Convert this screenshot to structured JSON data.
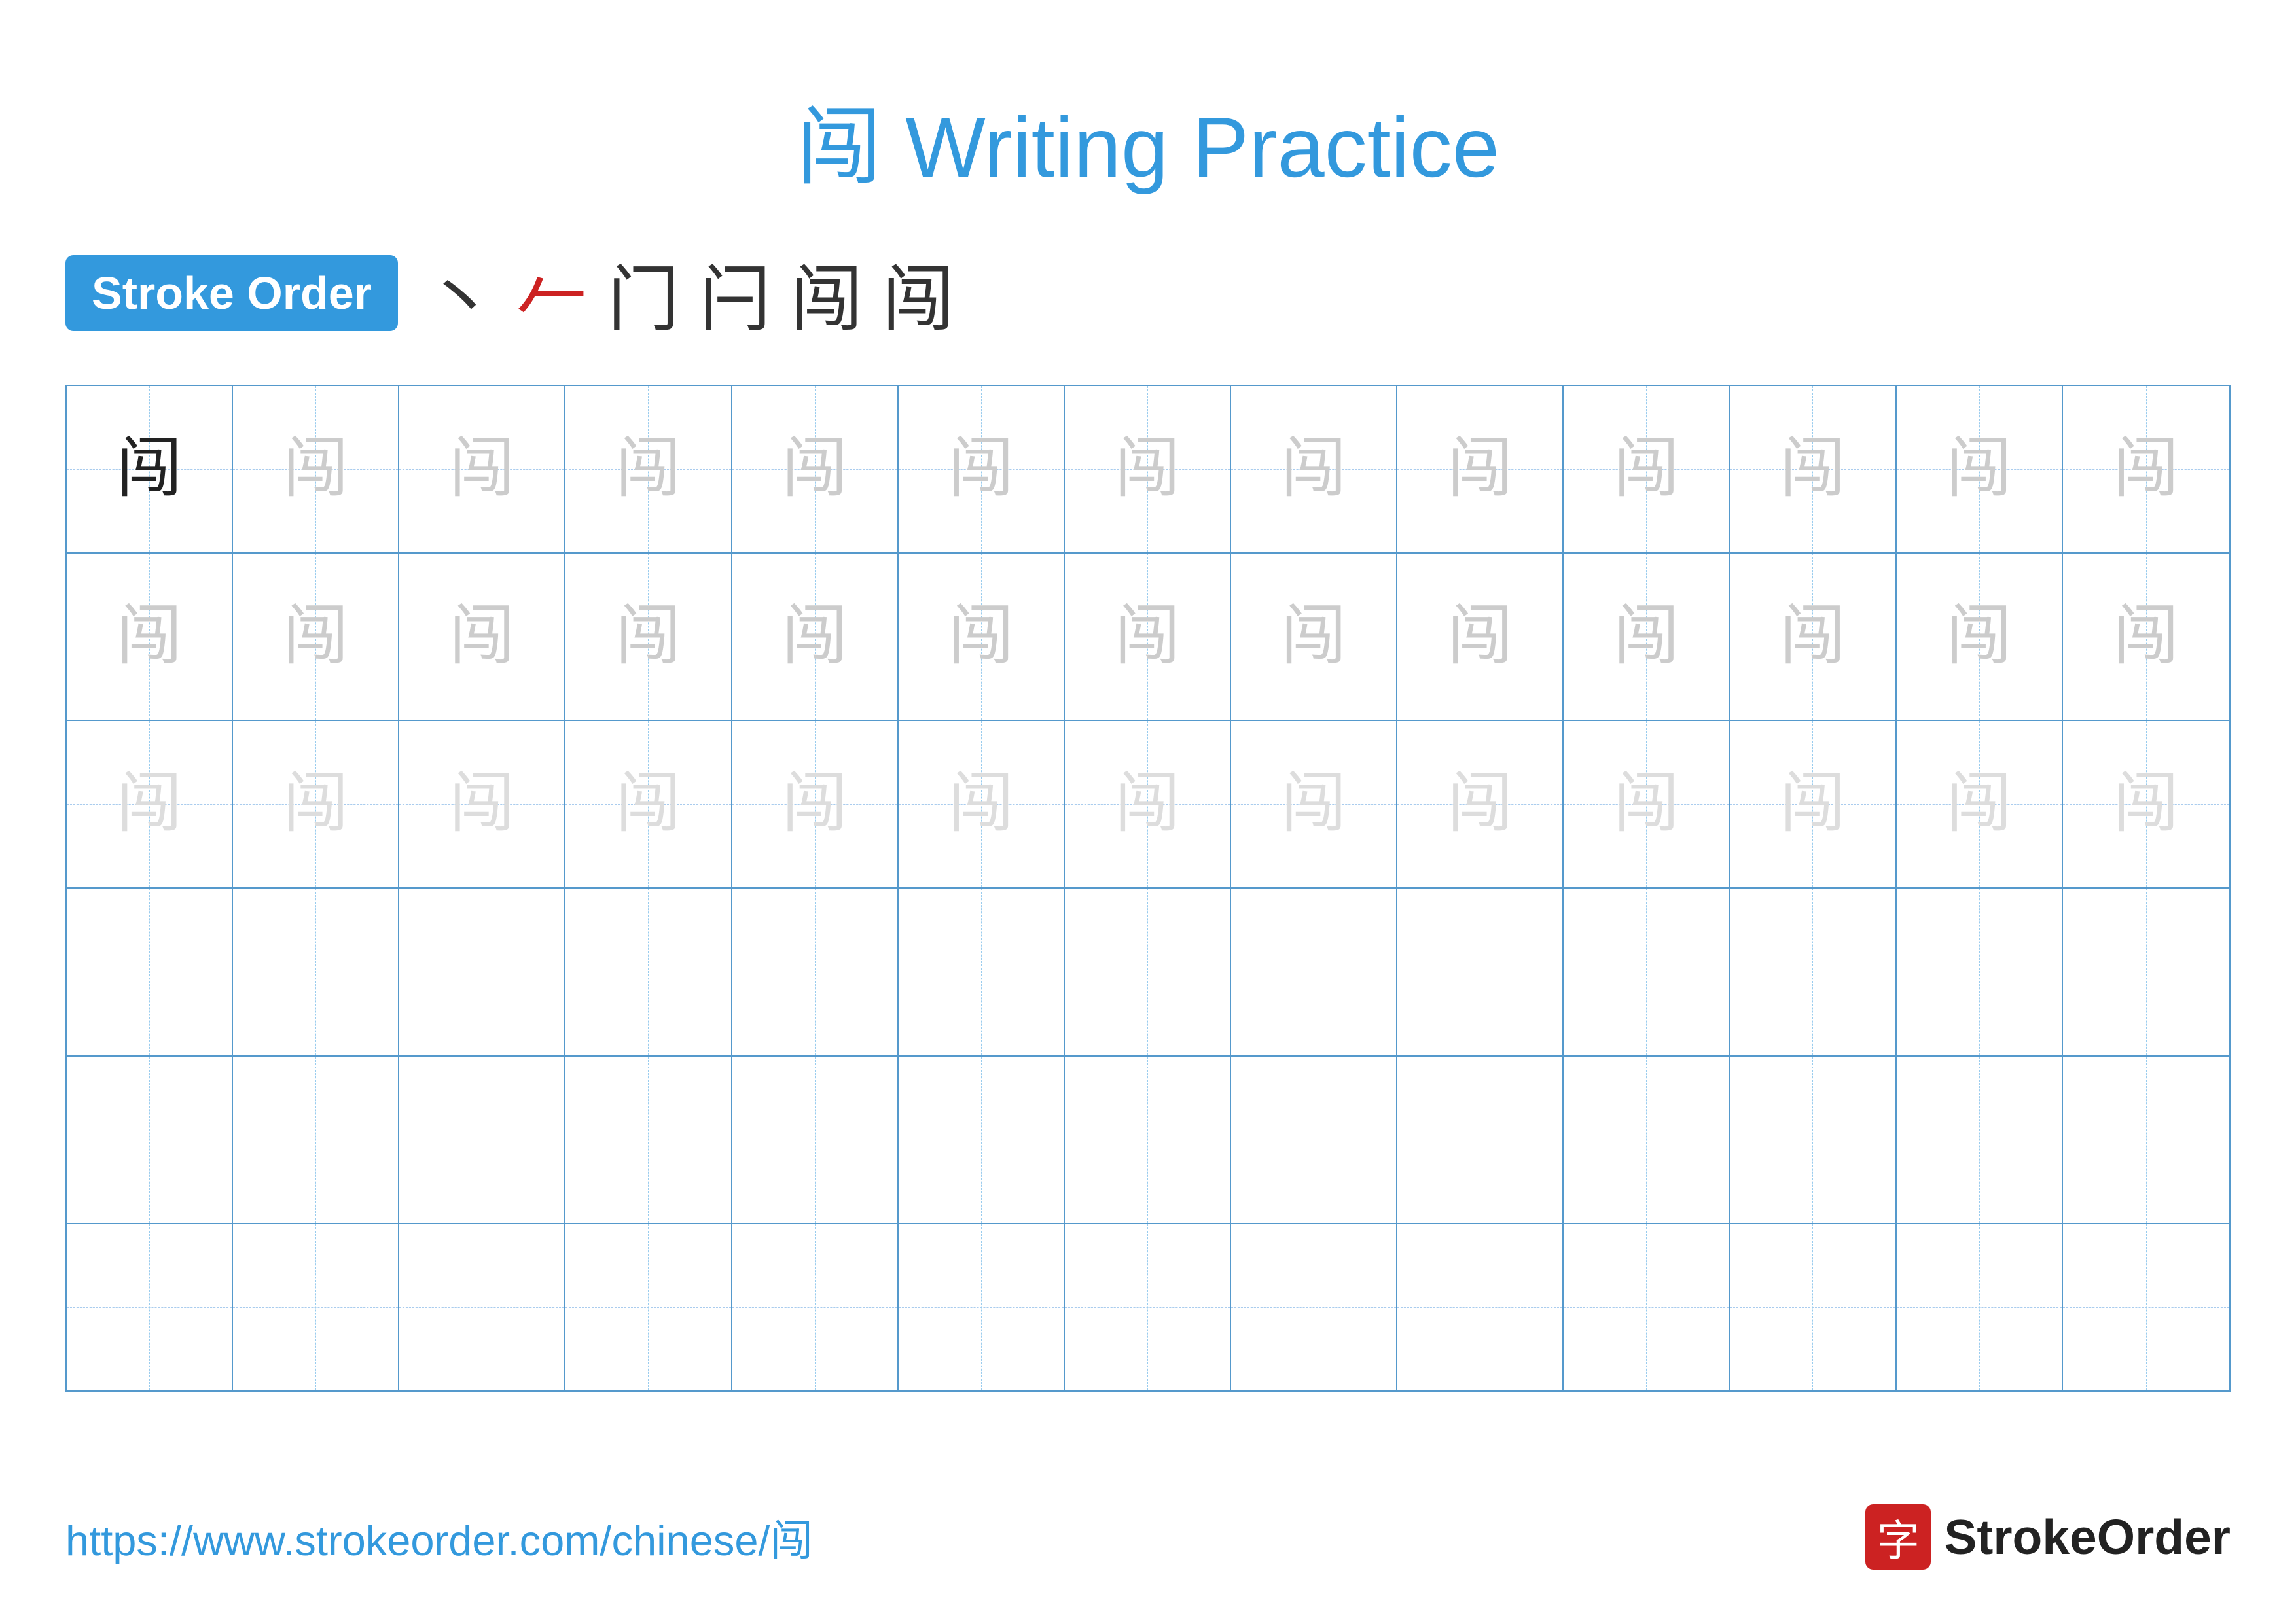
{
  "title": {
    "character": "闯",
    "text": " Writing Practice",
    "full": "闯 Writing Practice"
  },
  "stroke_order": {
    "badge_label": "Stroke Order",
    "strokes": [
      "丶",
      "𠂉",
      "门",
      "闩",
      "闯",
      "闯"
    ]
  },
  "grid": {
    "rows": 6,
    "cols": 13,
    "character": "闯",
    "row_types": [
      "solid-then-ghost-medium",
      "ghost-medium",
      "ghost-light",
      "empty",
      "empty",
      "empty"
    ]
  },
  "footer": {
    "url": "https://www.strokeorder.com/chinese/闯",
    "logo_char": "字",
    "logo_name": "StrokeOrder"
  },
  "colors": {
    "blue": "#3399dd",
    "red": "#cc2222",
    "grid_border": "#5599cc",
    "dashed": "#aaccee",
    "ghost_medium": "#cccccc",
    "ghost_light": "#dddddd",
    "solid": "#222222"
  }
}
